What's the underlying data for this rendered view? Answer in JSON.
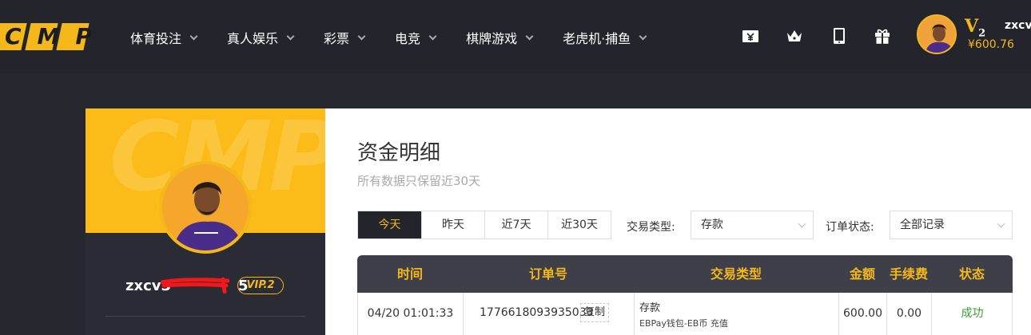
{
  "colors": {
    "accent": "#f5b81a",
    "nav_bg": "#24242d",
    "success": "#3aa036"
  },
  "brand": {
    "logo_text": "CMP",
    "watermark": "CMP"
  },
  "nav": {
    "items": [
      {
        "label": "体育投注"
      },
      {
        "label": "真人娱乐"
      },
      {
        "label": "彩票"
      },
      {
        "label": "电竞"
      },
      {
        "label": "棋牌游戏"
      },
      {
        "label": "老虎机·捕鱼"
      }
    ]
  },
  "top_icons": [
    "wallet-icon",
    "crown-icon",
    "mobile-icon",
    "gift-icon"
  ],
  "user": {
    "vip_top": "V",
    "vip_top_level": "2",
    "name_top": "zxcv",
    "balance": "¥600.76",
    "profile_name": "zxcv3",
    "profile_name_suffix": "5",
    "vip_badge": "VIP.2"
  },
  "page": {
    "title": "资金明细",
    "subtitle": "所有数据只保留近30天"
  },
  "filters": {
    "date_tabs": [
      "今天",
      "昨天",
      "近7天",
      "近30天"
    ],
    "active_tab": "今天",
    "type_label": "交易类型:",
    "type_value": "存款",
    "status_label": "订单状态:",
    "status_value": "全部记录"
  },
  "table": {
    "headers": [
      "时间",
      "订单号",
      "交易类型",
      "金额",
      "手续费",
      "状态"
    ],
    "rows": [
      {
        "time": "04/20 01:01:33",
        "order_no": "1776618093935033",
        "copy_label": "复制",
        "type": "存款",
        "type_detail": "EBPay钱包-EB币 充值",
        "amount": "600.00",
        "fee": "0.00",
        "status": "成功"
      }
    ]
  }
}
